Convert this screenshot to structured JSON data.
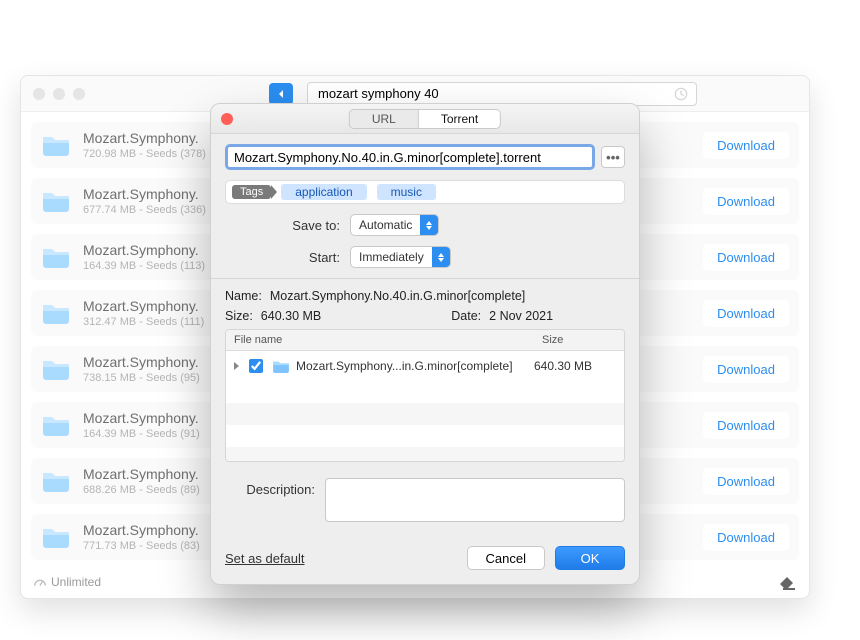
{
  "back": {
    "search_value": "mozart symphony 40",
    "download_label": "Download",
    "results": [
      {
        "title": "Mozart.Symphony.",
        "size": "720.98 MB",
        "seeds": "378"
      },
      {
        "title": "Mozart.Symphony.",
        "size": "677.74 MB",
        "seeds": "336"
      },
      {
        "title": "Mozart.Symphony.",
        "size": "164.39 MB",
        "seeds": "113"
      },
      {
        "title": "Mozart.Symphony.",
        "size": "312.47 MB",
        "seeds": "111"
      },
      {
        "title": "Mozart.Symphony.",
        "size": "738.15 MB",
        "seeds": "95"
      },
      {
        "title": "Mozart.Symphony.",
        "size": "164.39 MB",
        "seeds": "91"
      },
      {
        "title": "Mozart.Symphony.",
        "size": "688.26 MB",
        "seeds": "89"
      },
      {
        "title": "Mozart.Symphony.",
        "size": "771.73 MB",
        "seeds": "83"
      }
    ],
    "footer_status": "Unlimited"
  },
  "modal": {
    "tabs": {
      "url": "URL",
      "torrent": "Torrent"
    },
    "filename": "Mozart.Symphony.No.40.in.G.minor[complete].torrent",
    "tags_label": "Tags",
    "tags": [
      "application",
      "music"
    ],
    "save_to": {
      "label": "Save to:",
      "value": "Automatic"
    },
    "start": {
      "label": "Start:",
      "value": "Immediately"
    },
    "info": {
      "name_label": "Name:",
      "name_value": "Mozart.Symphony.No.40.in.G.minor[complete]",
      "size_label": "Size:",
      "size_value": "640.30 MB",
      "date_label": "Date:",
      "date_value": "2 Nov 2021"
    },
    "table": {
      "col_name": "File name",
      "col_size": "Size",
      "row_name": "Mozart.Symphony...in.G.minor[complete]",
      "row_size": "640.30 MB"
    },
    "description_label": "Description:",
    "set_default": "Set as default",
    "cancel": "Cancel",
    "ok": "OK"
  }
}
